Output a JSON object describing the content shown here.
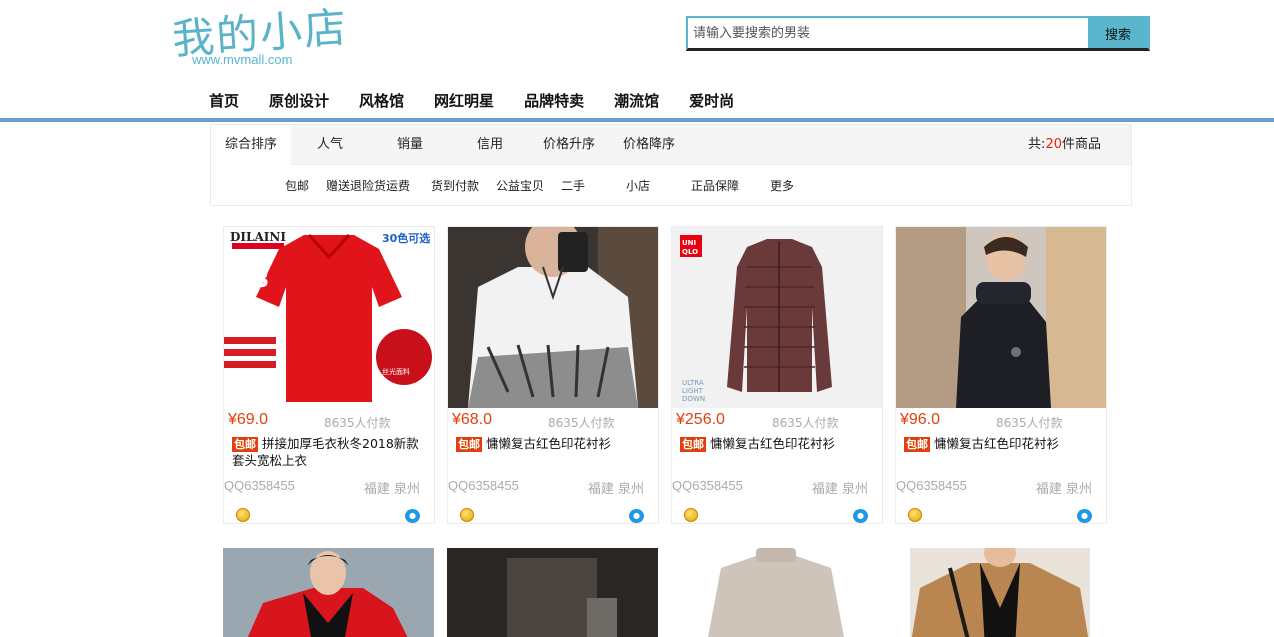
{
  "logo": {
    "text": "我的小店",
    "url_text": "www.mvmall.com"
  },
  "search": {
    "placeholder": "请输入要搜索的男装",
    "button_label": "搜索"
  },
  "nav": [
    "首页",
    "原创设计",
    "风格馆",
    "网红明星",
    "品牌特卖",
    "潮流馆",
    "爱时尚"
  ],
  "sort": {
    "items": [
      "综合排序",
      "人气",
      "销量",
      "信用",
      "价格升序",
      "价格降序"
    ],
    "active": "综合排序",
    "total_prefix": "共:",
    "total_count": "20",
    "total_suffix": "件商品"
  },
  "tags": [
    "包邮",
    "赠送退险货运费",
    "货到付款",
    "公益宝贝",
    "二手",
    "小店",
    "正品保障",
    "更多"
  ],
  "products": [
    {
      "price": "¥69.0",
      "paid": "8635人付款",
      "badge": "包邮",
      "title": "拼接加厚毛衣秋冬2018新款套头宽松上衣",
      "qq": "QQ6358455",
      "location": "福建 泉州",
      "image": "red-polo-shirt",
      "image_text": "DILAINI",
      "image_badge": "30色可选"
    },
    {
      "price": "¥68.0",
      "paid": "8635人付款",
      "badge": "包邮",
      "title": "慵懒复古红色印花衬衫",
      "qq": "QQ6358455",
      "location": "福建 泉州",
      "image": "white-printed-sweatshirt"
    },
    {
      "price": "¥256.0",
      "paid": "8635人付款",
      "badge": "包邮",
      "title": "慵懒复古红色印花衬衫",
      "qq": "QQ6358455",
      "location": "福建 泉州",
      "image": "brown-down-jacket",
      "image_text": "UNI QLO",
      "image_caption": "ULTRA LIGHT DOWN"
    },
    {
      "price": "¥96.0",
      "paid": "8635人付款",
      "badge": "包邮",
      "title": "慵懒复古红色印花衬衫",
      "qq": "QQ6358455",
      "location": "福建 泉州",
      "image": "black-winter-jacket"
    }
  ],
  "products_row2": [
    {
      "image": "red-black-jacket"
    },
    {
      "image": "dark-coat"
    },
    {
      "image": "beige-turtleneck"
    },
    {
      "image": "camel-coat"
    }
  ],
  "icons": {
    "medal": "gold-medal-icon",
    "chat": "chat-icon"
  },
  "colors": {
    "accent": "#5ab5cd",
    "price": "#e0400d",
    "nav_rule": "#6b9dcc"
  }
}
